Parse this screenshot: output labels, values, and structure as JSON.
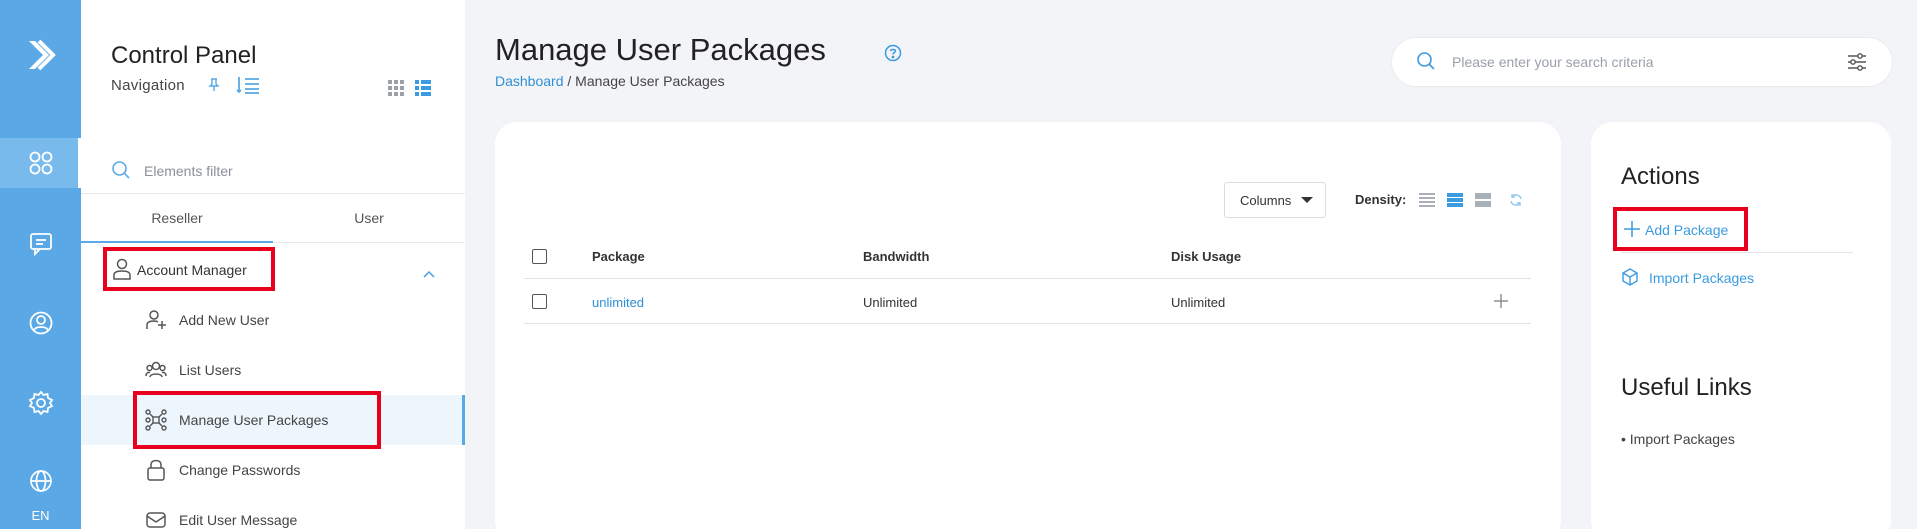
{
  "rail": {
    "icons": [
      "logo-icon",
      "apps-icon",
      "message-icon",
      "user-circle-icon",
      "settings-icon",
      "globe-icon"
    ],
    "lang": "EN"
  },
  "nav": {
    "title": "Control Panel",
    "subtitle": "Navigation",
    "filter_placeholder": "Elements filter",
    "tabs": [
      {
        "label": "Reseller",
        "active": true
      },
      {
        "label": "User",
        "active": false
      }
    ],
    "section": "Account Manager",
    "items": [
      {
        "label": "Add New User",
        "icon": "user-plus-icon"
      },
      {
        "label": "List Users",
        "icon": "users-icon"
      },
      {
        "label": "Manage User Packages",
        "icon": "packages-icon",
        "active": true
      },
      {
        "label": "Change Passwords",
        "icon": "lock-icon"
      },
      {
        "label": "Edit User Message",
        "icon": "mail-icon"
      }
    ]
  },
  "header": {
    "title": "Manage User Packages",
    "breadcrumb": {
      "home": "Dashboard",
      "sep": " / ",
      "current": "Manage User Packages"
    },
    "search_placeholder": "Please enter your search criteria"
  },
  "table": {
    "columns_button": "Columns",
    "density_label": "Density:",
    "headers": [
      "Package",
      "Bandwidth",
      "Disk Usage"
    ],
    "rows": [
      {
        "package": "unlimited",
        "bandwidth": "Unlimited",
        "disk": "Unlimited"
      }
    ]
  },
  "actions": {
    "title": "Actions",
    "add": "Add Package",
    "import": "Import Packages",
    "links_title": "Useful Links",
    "links": [
      "• Import Packages"
    ]
  },
  "colors": {
    "accent": "#5aa9e6",
    "link": "#2f8fd6",
    "highlight": "#e8001c"
  }
}
